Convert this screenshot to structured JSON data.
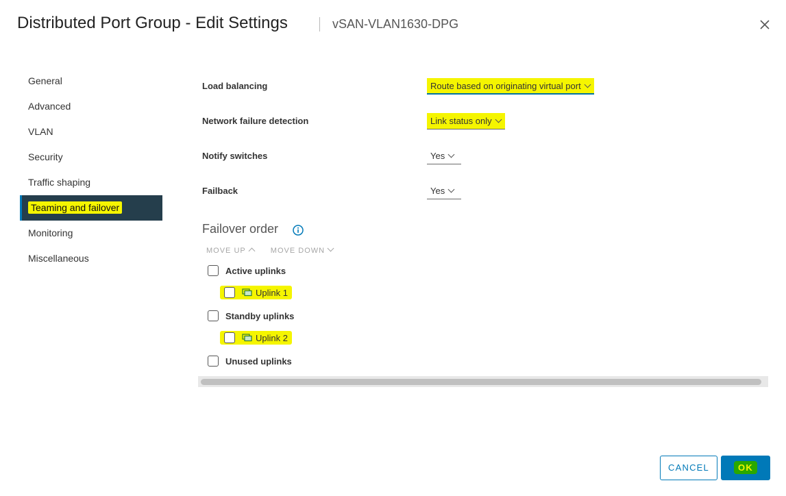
{
  "dialog": {
    "title": "Distributed Port Group - Edit Settings",
    "object_name": "vSAN-VLAN1630-DPG"
  },
  "nav": {
    "items": [
      {
        "label": "General"
      },
      {
        "label": "Advanced"
      },
      {
        "label": "VLAN"
      },
      {
        "label": "Security"
      },
      {
        "label": "Traffic shaping"
      },
      {
        "label": "Teaming and failover"
      },
      {
        "label": "Monitoring"
      },
      {
        "label": "Miscellaneous"
      }
    ],
    "selected": "Teaming and failover"
  },
  "settings": {
    "load_balancing": {
      "label": "Load balancing",
      "value": "Route based on originating virtual port"
    },
    "network_failure_detection": {
      "label": "Network failure detection",
      "value": "Link status only"
    },
    "notify_switches": {
      "label": "Notify switches",
      "value": "Yes"
    },
    "failback": {
      "label": "Failback",
      "value": "Yes"
    }
  },
  "failover": {
    "title": "Failover order",
    "move_up": "MOVE UP",
    "move_down": "MOVE DOWN",
    "active_label": "Active uplinks",
    "active_uplink": "Uplink 1",
    "standby_label": "Standby uplinks",
    "standby_uplink": "Uplink 2",
    "unused_label": "Unused uplinks"
  },
  "footer": {
    "cancel": "CANCEL",
    "ok": "OK"
  },
  "colors": {
    "accent": "#0079b8",
    "nav_active_bg": "#253e4c",
    "highlight": "#f5f500"
  }
}
